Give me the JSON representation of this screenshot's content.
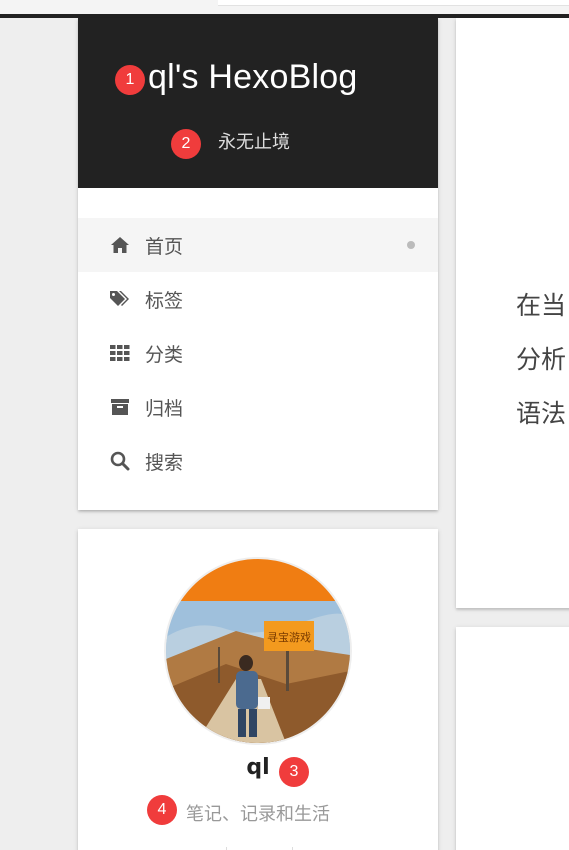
{
  "site": {
    "title": "ql's HexoBlog",
    "subtitle": "永无止境"
  },
  "menu": {
    "items": [
      {
        "label": "首页",
        "icon": "home-icon",
        "active": true
      },
      {
        "label": "标签",
        "icon": "tags-icon",
        "active": false
      },
      {
        "label": "分类",
        "icon": "grid-icon",
        "active": false
      },
      {
        "label": "归档",
        "icon": "archive-icon",
        "active": false
      },
      {
        "label": "搜索",
        "icon": "search-icon",
        "active": false
      }
    ]
  },
  "author": {
    "name": "ql",
    "description": "笔记、记录和生活",
    "avatar_poster_text": "寻宝游戏"
  },
  "post_preview": {
    "lines": [
      "在当",
      "分析",
      "语法"
    ]
  },
  "annotations": [
    "1",
    "2",
    "3",
    "4"
  ],
  "colors": {
    "header_bg": "#222222",
    "badge": "#f03c3c",
    "menu_text": "#555555",
    "active_bg": "#f5f5f5"
  }
}
